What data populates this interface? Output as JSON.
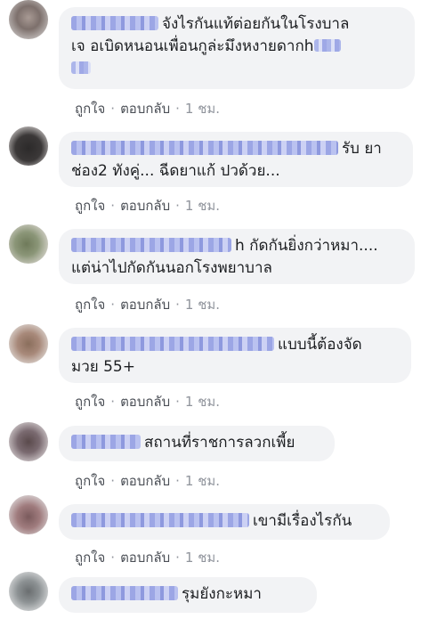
{
  "actions": {
    "like": "ถูกใจ",
    "reply": "ตอบกลับ",
    "separator": "·"
  },
  "comments": [
    {
      "lines": [
        "จังไรกันแท้ต่อยกันในโรงบาล",
        "เจ อเบิดหนอนเพื่อนกูล่ะมึงหงายดากh"
      ],
      "time": "1 ชม."
    },
    {
      "lines": [
        "รับ ยา",
        "ช่อง2 ทังคู่... ฉีดยาแก้ ปวด้วย..."
      ],
      "time": "1 ชม."
    },
    {
      "lines": [
        "h กัดกันยิ่งกว่าหมา....",
        "แต่น่าไปกัดกันนอกโรงพยาบาล"
      ],
      "time": "1 ชม."
    },
    {
      "lines": [
        "แบบนี้ต้องจัด",
        "มวย 55+"
      ],
      "time": "1 ชม."
    },
    {
      "lines": [
        "สถานที่ราชการลวกเพี้ย"
      ],
      "time": "1 ชม."
    },
    {
      "lines": [
        "เขามีเรื่องไรกัน"
      ],
      "time": "1 ชม."
    },
    {
      "lines": [
        "รุมยังกะหมา"
      ]
    }
  ]
}
